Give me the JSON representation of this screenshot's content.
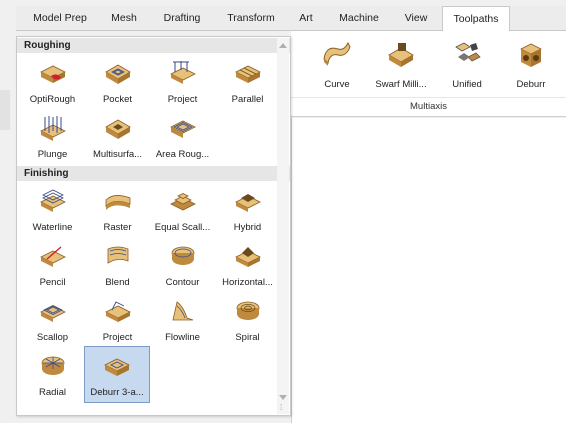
{
  "ribbon": {
    "tabs": [
      {
        "label": "Model Prep"
      },
      {
        "label": "Mesh"
      },
      {
        "label": "Drafting"
      },
      {
        "label": "Transform"
      },
      {
        "label": "Art"
      },
      {
        "label": "Machine"
      },
      {
        "label": "View"
      },
      {
        "label": "Toolpaths",
        "active": true
      }
    ]
  },
  "gallery": {
    "sections": [
      {
        "title": "Roughing",
        "items": [
          {
            "label": "OptiRough",
            "icon": "optirough-icon"
          },
          {
            "label": "Pocket",
            "icon": "pocket-icon"
          },
          {
            "label": "Project",
            "icon": "project-icon"
          },
          {
            "label": "Parallel",
            "icon": "parallel-icon"
          },
          {
            "label": "Plunge",
            "icon": "plunge-icon"
          },
          {
            "label": "Multisurfa...",
            "icon": "multisurface-icon"
          },
          {
            "label": "Area Roug...",
            "icon": "area-roughing-icon"
          }
        ]
      },
      {
        "title": "Finishing",
        "items": [
          {
            "label": "Waterline",
            "icon": "waterline-icon"
          },
          {
            "label": "Raster",
            "icon": "raster-icon"
          },
          {
            "label": "Equal Scall...",
            "icon": "equal-scallop-icon"
          },
          {
            "label": "Hybrid",
            "icon": "hybrid-icon"
          },
          {
            "label": "Pencil",
            "icon": "pencil-icon"
          },
          {
            "label": "Blend",
            "icon": "blend-icon"
          },
          {
            "label": "Contour",
            "icon": "contour-icon"
          },
          {
            "label": "Horizontal...",
            "icon": "horizontal-icon"
          },
          {
            "label": "Scallop",
            "icon": "scallop-icon"
          },
          {
            "label": "Project",
            "icon": "project-finish-icon"
          },
          {
            "label": "Flowline",
            "icon": "flowline-icon"
          },
          {
            "label": "Spiral",
            "icon": "spiral-icon"
          },
          {
            "label": "Radial",
            "icon": "radial-icon"
          },
          {
            "label": "Deburr 3-a...",
            "icon": "deburr-3-axis-icon",
            "selected": true
          }
        ]
      }
    ]
  },
  "multiaxis": {
    "group_label": "Multiaxis",
    "items": [
      {
        "label": "Curve",
        "icon": "curve-icon"
      },
      {
        "label": "Swarf Milli...",
        "icon": "swarf-milling-icon"
      },
      {
        "label": "Unified",
        "icon": "unified-icon"
      },
      {
        "label": "Deburr",
        "icon": "deburr-icon"
      }
    ]
  },
  "colors": {
    "accent": "#c6d9ef",
    "part_top": "#e7c07a",
    "part_side": "#c08a3e",
    "toolpath": "#3a4a8a"
  }
}
